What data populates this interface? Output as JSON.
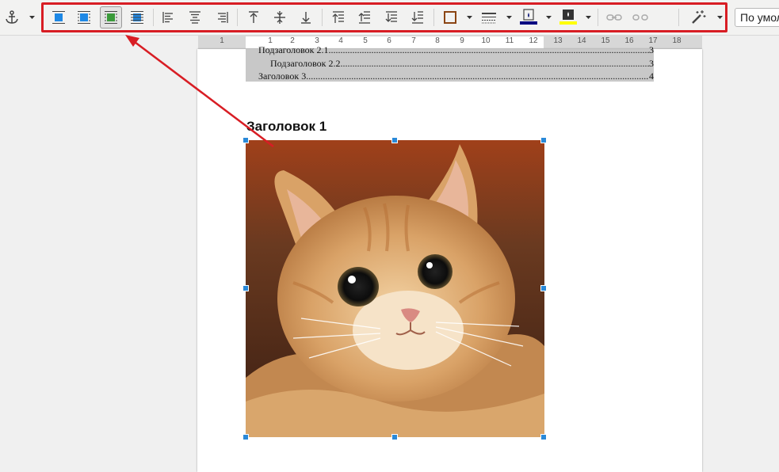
{
  "toolbar": {
    "style_combo_value": "По умол"
  },
  "ruler": {
    "numbers": [
      "1",
      "1",
      "2",
      "3",
      "4",
      "5",
      "6",
      "7",
      "8",
      "9",
      "10",
      "11",
      "12",
      "13",
      "14",
      "15",
      "16",
      "17",
      "18"
    ]
  },
  "toc": {
    "entries": [
      {
        "text": "Подзаголовок 2.1",
        "page": "3"
      },
      {
        "text": "Подзаголовок 2.2",
        "page": "3"
      },
      {
        "text": "Заголовок 3",
        "page": "4"
      }
    ]
  },
  "document": {
    "heading": "Заголовок 1"
  },
  "colors": {
    "highlight_red": "#d81d24",
    "handle_blue": "#2a89d8"
  }
}
